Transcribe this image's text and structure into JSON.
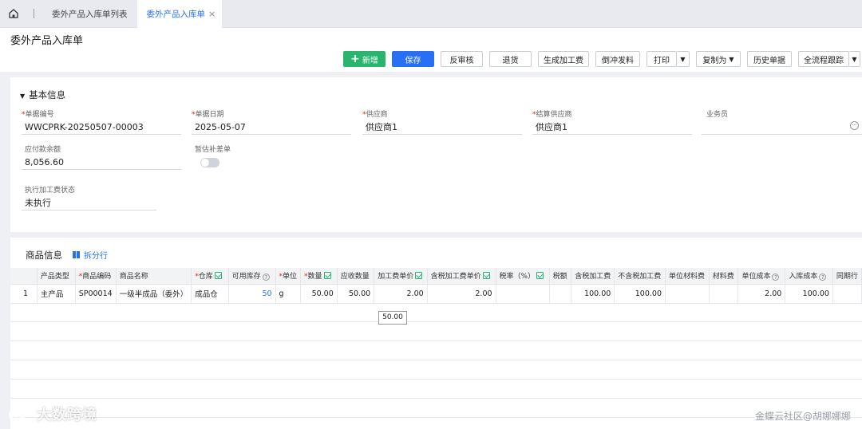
{
  "tabs": {
    "list_tab": "委外产品入库单列表",
    "active_tab": "委外产品入库单",
    "close": "×"
  },
  "page": {
    "title": "委外产品入库单"
  },
  "toolbar": {
    "new": "新增",
    "save": "保存",
    "unaudit": "反审核",
    "return": "退货",
    "gen_fee": "生成加工费",
    "reverse_issue": "倒冲发料",
    "print": "打印",
    "copy_as": "复制为",
    "history": "历史单据",
    "trace": "全流程跟踪"
  },
  "basic_info": {
    "section_title": "基本信息",
    "doc_no_label": "单据编号",
    "doc_no": "WWCPRK-20250507-00003",
    "doc_date_label": "单据日期",
    "doc_date": "2025-05-07",
    "supplier_label": "供应商",
    "supplier": "供应商1",
    "settle_supplier_label": "结算供应商",
    "settle_supplier": "供应商1",
    "salesman_label": "业务员",
    "salesman": "",
    "payable_label": "应付款余额",
    "payable": "8,056.60",
    "estimate_label": "暂估补差单",
    "exec_status_label": "执行加工费状态",
    "exec_status": "未执行"
  },
  "goods": {
    "section_title": "商品信息",
    "split_row": "拆分行",
    "columns": [
      "",
      "产品类型",
      "商品编码",
      "商品名称",
      "仓库",
      "可用库存",
      "单位",
      "数量",
      "应收数量",
      "加工费单价",
      "含税加工费单价",
      "税率（%）",
      "税额",
      "含税加工费",
      "不含税加工费",
      "单位材料费",
      "材料费",
      "单位成本",
      "入库成本",
      "同期行"
    ],
    "rows": [
      {
        "idx": "1",
        "type": "主产品",
        "code": "SP00014",
        "name": "一级半成品（委外）",
        "warehouse": "成品仓",
        "stock": "50",
        "unit": "g",
        "qty": "50.00",
        "recv_qty": "50.00",
        "fee_price": "2.00",
        "tax_fee_price": "2.00",
        "tax_rate": "",
        "tax": "",
        "tax_fee": "100.00",
        "notax_fee": "100.00",
        "unit_material": "",
        "material": "",
        "unit_cost": "2.00",
        "in_cost": "100.00",
        "same": ""
      }
    ],
    "tooltip": "50.00"
  },
  "watermark": {
    "left": "大数跨境",
    "right": "金蝶云社区@胡娜娜娜"
  },
  "colors": {
    "primary": "#276ff5",
    "green": "#29b56e",
    "required": "#e02020"
  }
}
